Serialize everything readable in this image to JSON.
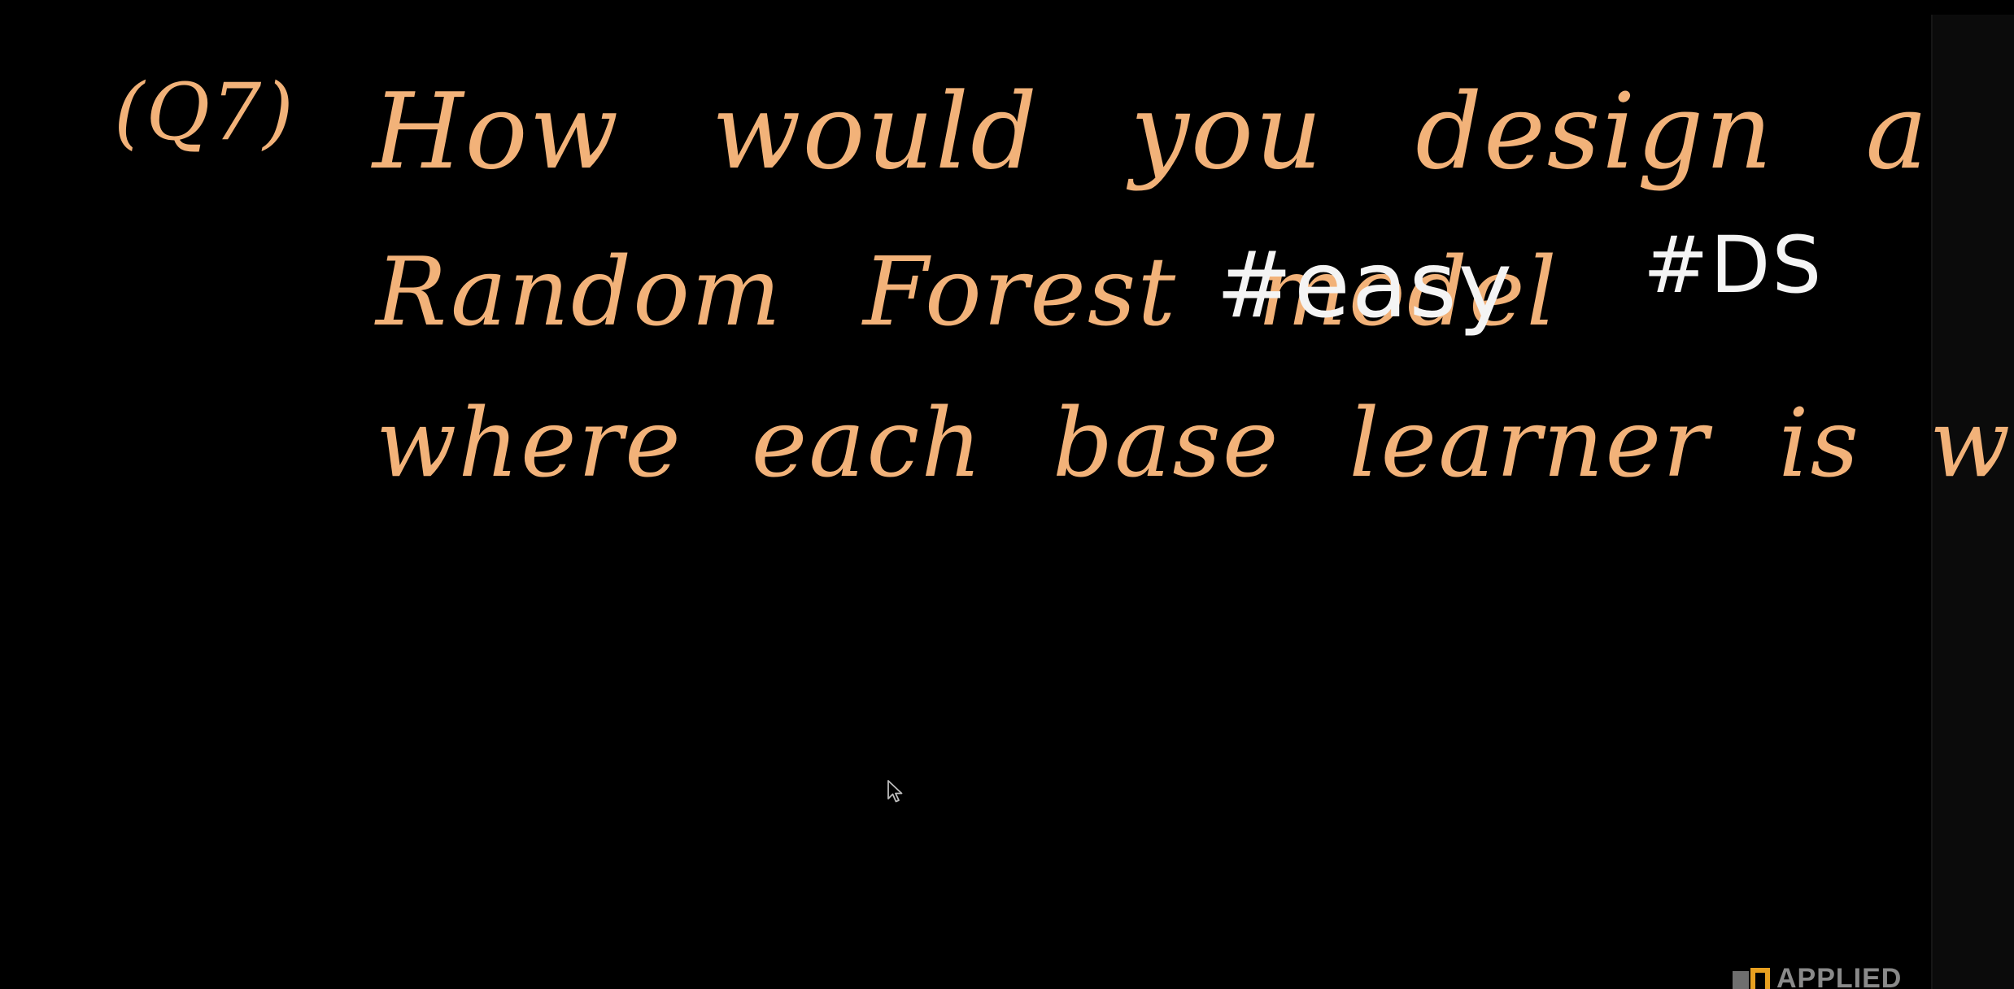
{
  "board": {
    "question_label": "(Q7)",
    "line1": "How would you design a weighted",
    "line2": "Random Forest model",
    "tag_easy": "#easy",
    "tag_ds": "#DS",
    "line3": "where each base learner is weighted."
  },
  "watermark": {
    "text": "APPLIED"
  },
  "colors": {
    "background": "#000000",
    "handwriting_orange": "#f2b279",
    "handwriting_white": "#f4f4f4",
    "logo_accent": "#e8a020"
  },
  "icons": {
    "cursor": "mouse-pointer-icon",
    "logo": "applied-logo-icon"
  }
}
